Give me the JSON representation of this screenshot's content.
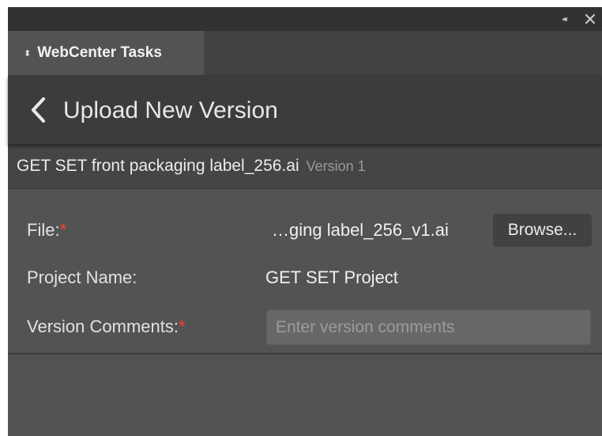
{
  "colors": {
    "panel_bg": "#535353",
    "titlebar_bg": "#323232",
    "header_bg": "#3c3c3c",
    "filebar_bg": "#454545",
    "required_marker": "#ff3b30"
  },
  "titlebar": {
    "collapse_icon": "double-chevron-left-icon",
    "collapse_glyph": "◂◂",
    "close_icon": "close-icon"
  },
  "tabs": [
    {
      "label": "WebCenter Tasks",
      "icon": "up-down-arrows-icon",
      "glyph": "⬍",
      "active": true
    }
  ],
  "header": {
    "back_icon": "chevron-left-icon",
    "title": "Upload New Version"
  },
  "document": {
    "name": "GET SET front packaging label_256.ai",
    "version": "Version 1"
  },
  "form": {
    "file": {
      "label": "File:",
      "required_marker": "*",
      "value": "…ging label_256_v1.ai",
      "browse_label": "Browse..."
    },
    "project": {
      "label": "Project Name:",
      "value": "GET SET Project"
    },
    "comments": {
      "label": "Version Comments:",
      "required_marker": "*",
      "value": "",
      "placeholder": "Enter version comments"
    }
  }
}
